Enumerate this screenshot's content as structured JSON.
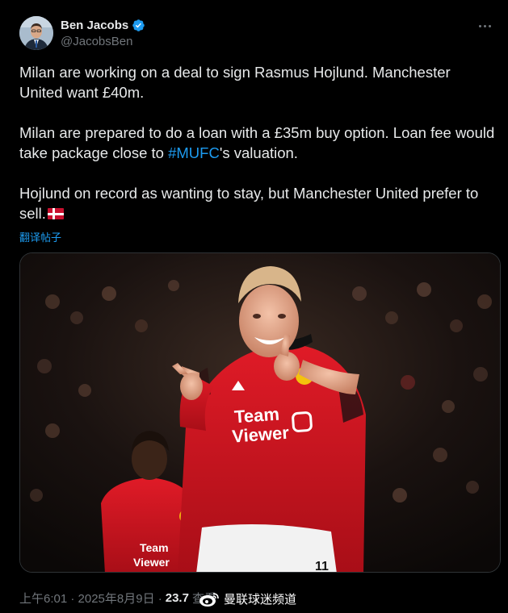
{
  "author": {
    "display_name": "Ben Jacobs",
    "handle": "@JacobsBen",
    "verified": true
  },
  "tweet": {
    "paragraphs": [
      {
        "text": "Milan are working on a deal to sign Rasmus Hojlund. Manchester United want £40m."
      },
      {
        "before": "Milan are prepared to do a loan with a £35m buy option. Loan fee would take package close to ",
        "hashtag": "#MUFC",
        "after": "'s valuation."
      },
      {
        "text": "Hojlund on record as wanting to stay, but Manchester United prefer to sell.",
        "flag": "denmark-flag"
      }
    ]
  },
  "translate_label": "翻译帖子",
  "media": {
    "shirt_sponsor": "Team Viewer",
    "shirt_number": "11"
  },
  "meta": {
    "timestamp": "上午6:01 · 2025年8月9日 · ",
    "views": "23.7",
    "views_label": "查看"
  },
  "watermark": {
    "text": "曼联球迷频道",
    "logo": "weibo-logo"
  },
  "colors": {
    "background": "#000000",
    "text": "#e7e9ea",
    "muted": "#71767b",
    "link": "#1d9bf0",
    "verified": "#1d9bf0",
    "kit_red": "#d01622"
  },
  "icons": [
    "verified-badge-icon",
    "more-options-icon",
    "denmark-flag-icon",
    "weibo-logo-icon"
  ]
}
